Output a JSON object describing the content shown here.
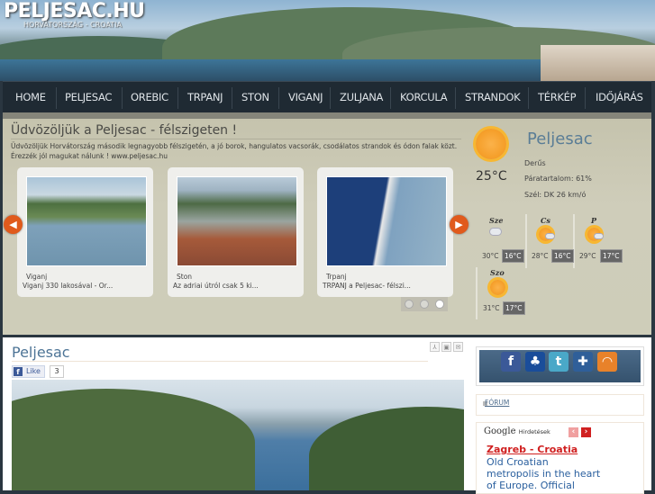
{
  "header": {
    "logo": "PELJESAC.HU",
    "subtitle": "HORVÁTORSZÁG - CROATIA"
  },
  "nav": {
    "items": [
      {
        "label": "HOME",
        "active": true
      },
      {
        "label": "PELJESAC"
      },
      {
        "label": "OREBIC"
      },
      {
        "label": "TRPANJ"
      },
      {
        "label": "STON"
      },
      {
        "label": "VIGANJ"
      },
      {
        "label": "ZULJANA"
      },
      {
        "label": "KORCULA"
      },
      {
        "label": "STRANDOK"
      },
      {
        "label": "TÉRKÉP"
      },
      {
        "label": "IDŐJÁRÁS"
      }
    ]
  },
  "feature": {
    "title": "Üdvözöljük a Peljesac - félszigeten !",
    "text1": "Üdvözöljük Horvátország második legnagyobb félszigetén, a jó borok, hangulatos vacsorák, csodálatos strandok és ódon falak közt.",
    "text2": "Érezzék jól magukat nálunk ! www.peljesac.hu",
    "cards": [
      {
        "title": "Viganj",
        "desc": "Viganj 330 lakosával - Or..."
      },
      {
        "title": "Ston",
        "desc": "Az adriai útról csak 5 ki..."
      },
      {
        "title": "Trpanj",
        "desc": "TRPANJ a Peljesac- félszi..."
      }
    ],
    "prev_icon": "arrow-left-icon",
    "next_icon": "arrow-right-icon",
    "active_dot": 3
  },
  "weather": {
    "city": "Peljesac",
    "temp": "25°C",
    "condition": "Derűs",
    "humidity": "Páratartalom: 61%",
    "wind": "Szél: DK 26 km/ó",
    "forecast": [
      {
        "day": "Sze",
        "high": "30°C",
        "low": "16°C",
        "icon": "thunderstorm-icon"
      },
      {
        "day": "Cs",
        "high": "28°C",
        "low": "16°C",
        "icon": "sun-cloud-rain-icon"
      },
      {
        "day": "P",
        "high": "29°C",
        "low": "17°C",
        "icon": "sun-cloud-rain-icon"
      },
      {
        "day": "Szo",
        "high": "31°C",
        "low": "17°C",
        "icon": "sun-icon"
      }
    ]
  },
  "content": {
    "title": "Peljesac",
    "like_label": "Like",
    "like_count": "3"
  },
  "sidebar": {
    "forum_label": "FÓRUM",
    "ads_brand": "Google",
    "ads_label": "Hirdetések",
    "ad_title": "Zagreb - Croatia",
    "ad_lines": [
      "Old Croatian",
      "metropolis in the heart",
      "of Europe. Official"
    ]
  },
  "colors": {
    "nav_bg": "#1f2a33",
    "feature_bg": "#cfcdb9",
    "accent_orange": "#e05a1c",
    "title_blue": "#4d7496",
    "ad_red": "#d02020"
  }
}
